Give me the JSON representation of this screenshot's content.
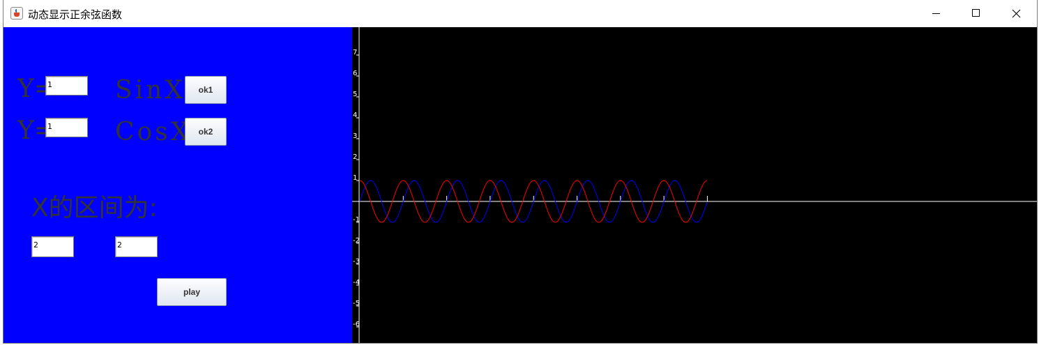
{
  "window": {
    "title": "动态显示正余弦函数",
    "controls": [
      "minimize",
      "maximize",
      "close"
    ]
  },
  "left_panel": {
    "background_color": "#0000ff",
    "label_color": "#333333",
    "sin_row": {
      "y_label": "Y=",
      "amplitude_value": "1",
      "func_label": "SinX",
      "button_label": "ok1"
    },
    "cos_row": {
      "y_label": "Y=",
      "amplitude_value": "1",
      "func_label": "CosX",
      "button_label": "ok2"
    },
    "interval_label": "X的区间为:",
    "interval_start_value": "2",
    "interval_end_value": "2",
    "play_button_label": "play"
  },
  "graph": {
    "background_color": "#000000",
    "axis_color": "#ffffff",
    "y_tick_labels": [
      "7",
      "6",
      "5",
      "4",
      "3",
      "2",
      "1",
      "-1",
      "-2",
      "-3",
      "-4",
      "-5",
      "-6"
    ],
    "series": [
      {
        "function": "sin",
        "amplitude": 1,
        "color": "#0000ff"
      },
      {
        "function": "cos",
        "amplitude": 1,
        "color": "#ff0000"
      }
    ],
    "periods_drawn": 8,
    "x_tick_count": 8
  }
}
